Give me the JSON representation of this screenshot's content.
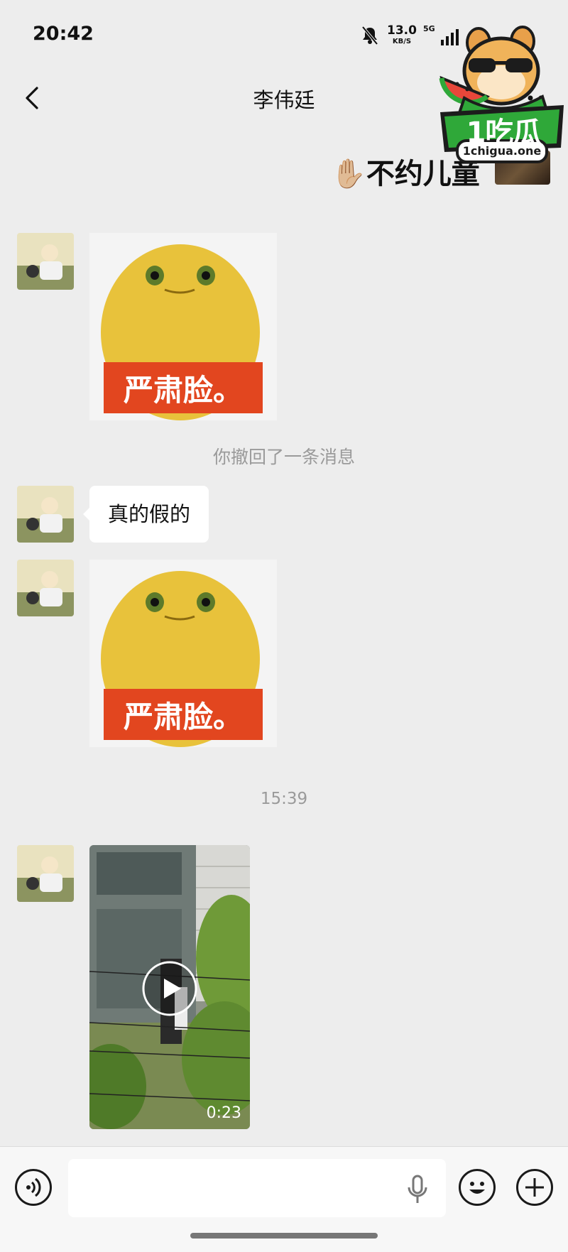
{
  "status_bar": {
    "time": "20:42",
    "net_speed": "13.0",
    "net_unit": "KB/S",
    "network": "5G",
    "icons": [
      "bell-muted-icon",
      "signal-icon"
    ]
  },
  "header": {
    "title": "李伟廷",
    "back_icon": "chevron-left-icon"
  },
  "watermark": {
    "brand": "1吃瓜",
    "url": "1chigua.one"
  },
  "messages": {
    "quote_emoji": "✋🏼",
    "quote_text": "不约儿童",
    "sticker_caption": "严肃脸。",
    "recall_notice": "你撤回了一条消息",
    "text_bubble": "真的假的",
    "timestamp": "15:39",
    "video_duration": "0:23"
  },
  "input_bar": {
    "voice_icon": "voice-icon",
    "mic_icon": "mic-icon",
    "emoji_icon": "emoji-icon",
    "plus_icon": "plus-icon",
    "placeholder": ""
  },
  "colors": {
    "background": "#ededed",
    "bubble": "#ffffff",
    "sticker_body": "#e8c23b",
    "sticker_banner": "#e2461f",
    "logo_green": "#2fa839"
  }
}
